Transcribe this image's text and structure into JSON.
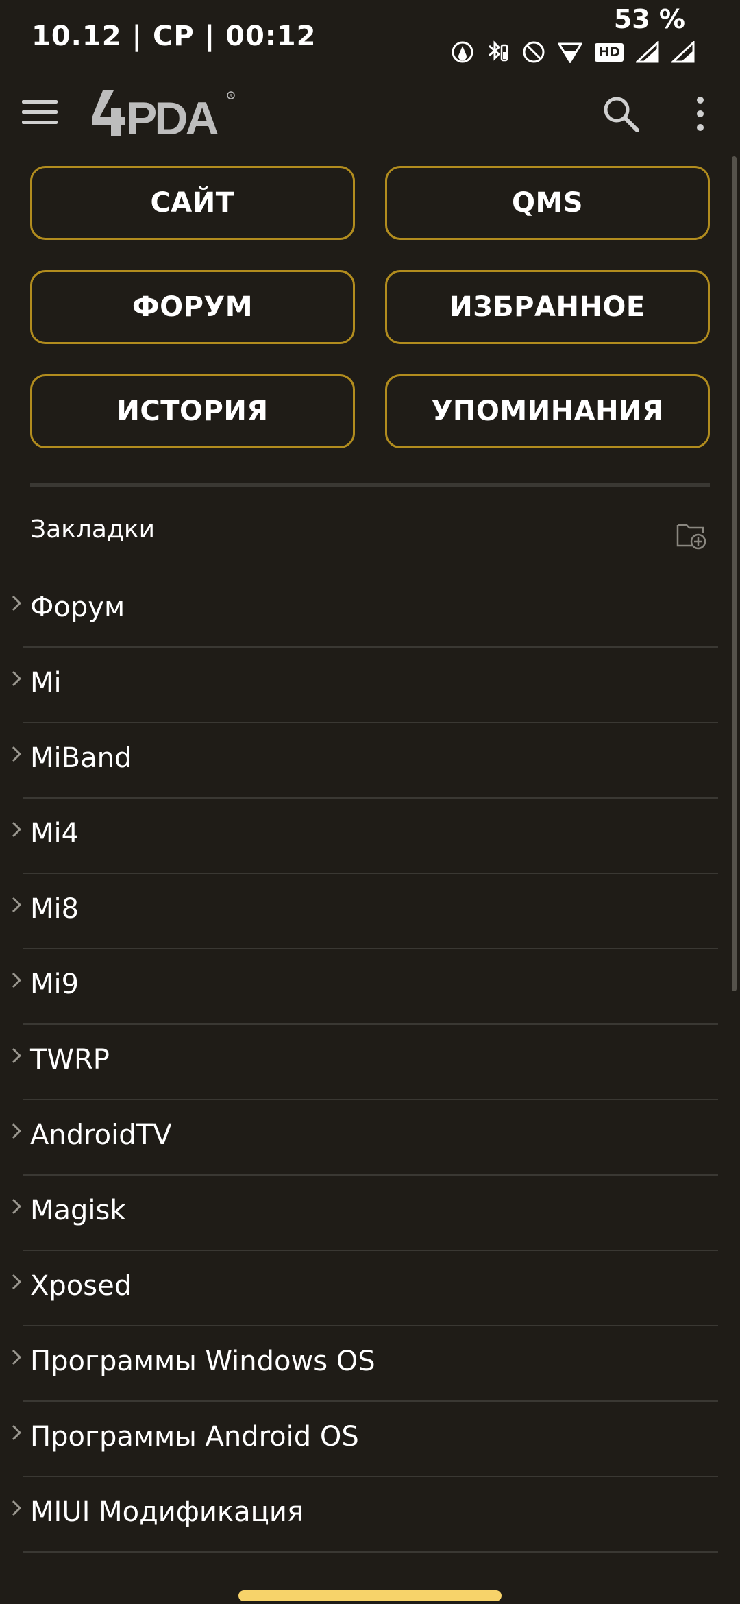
{
  "status_bar": {
    "time": "10.12 | СР |  00:12",
    "battery": "53 %",
    "hd_label": "HD"
  },
  "app_bar": {
    "logo_text": "4PDA",
    "logo_color": "#bdbdbd",
    "icons": [
      "menu-icon",
      "search-icon",
      "more-vert-icon"
    ]
  },
  "quick_buttons": [
    {
      "label": "САЙТ"
    },
    {
      "label": "QMS"
    },
    {
      "label": "ФОРУМ"
    },
    {
      "label": "ИЗБРАННОЕ"
    },
    {
      "label": "ИСТОРИЯ"
    },
    {
      "label": "УПОМИНАНИЯ"
    }
  ],
  "bookmarks": {
    "header": "Закладки",
    "items": [
      {
        "label": "Форум"
      },
      {
        "label": "Mi"
      },
      {
        "label": "MiBand"
      },
      {
        "label": "Mi4"
      },
      {
        "label": "Mi8"
      },
      {
        "label": "Mi9"
      },
      {
        "label": "TWRP"
      },
      {
        "label": "AndroidTV"
      },
      {
        "label": "Magisk"
      },
      {
        "label": "Xposed"
      },
      {
        "label": "Программы Windows OS"
      },
      {
        "label": "Программы Android OS"
      },
      {
        "label": "MIUI Модификация"
      }
    ]
  },
  "colors": {
    "background": "#1f1c17",
    "accent_border": "#b18c1e",
    "divider": "#3a3833",
    "home_indicator": "#f7d36a"
  }
}
